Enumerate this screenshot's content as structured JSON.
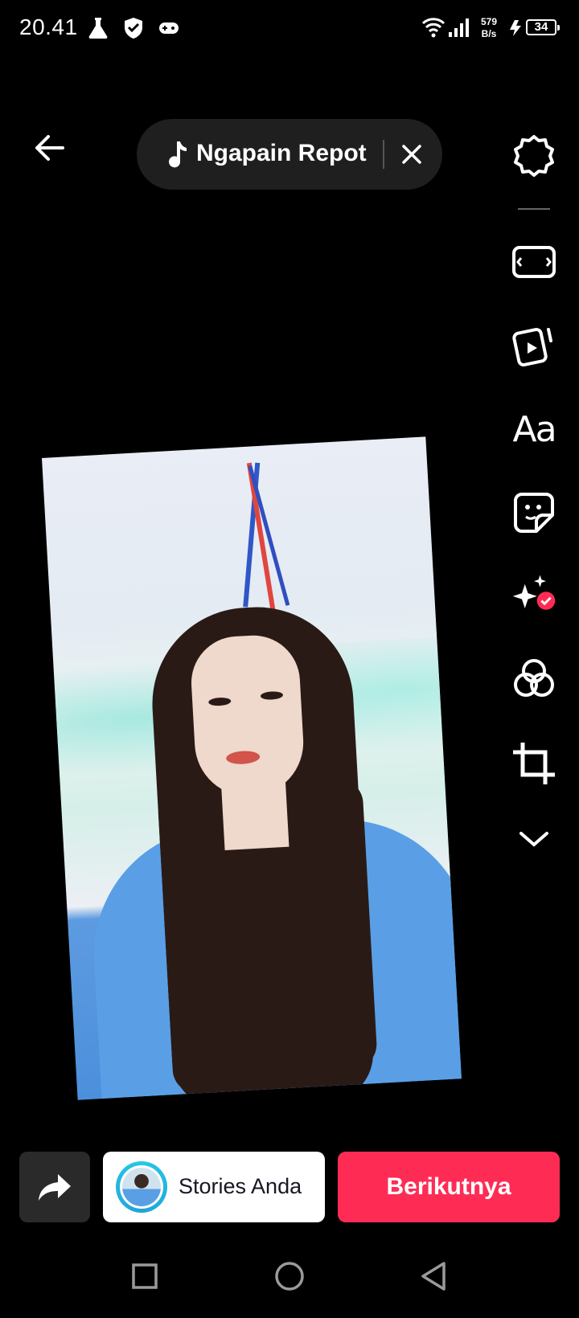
{
  "status_bar": {
    "time": "20.41",
    "net_speed_value": "579",
    "net_speed_unit": "B/s",
    "battery": "34",
    "icons": [
      "flask-icon",
      "shield-icon",
      "gamepad-icon",
      "wifi-icon",
      "signal-icon",
      "charging-icon"
    ]
  },
  "top_bar": {
    "back_icon": "arrow-left-icon",
    "sound_title": "Ngapain Repot",
    "sound_icon": "music-note-icon",
    "remove_sound_icon": "close-icon"
  },
  "tools": [
    "settings-icon",
    "aspect-ratio-icon",
    "templates-icon",
    "text-icon",
    "sticker-icon",
    "effects-icon",
    "filters-icon",
    "crop-icon",
    "more-chevron-icon"
  ],
  "tools_text": {
    "text_tool": "Aa"
  },
  "bottom_bar": {
    "share_icon": "share-arrow-icon",
    "stories_label": "Stories Anda",
    "next_label": "Berikutnya"
  },
  "colors": {
    "accent": "#fe2c55",
    "pill_bg": "#1f1f1f",
    "story_ring": "#28c7e8",
    "effects_badge": "#fe2c55"
  },
  "nav_bar": [
    "recent-apps-icon",
    "home-icon",
    "back-triangle-icon"
  ]
}
